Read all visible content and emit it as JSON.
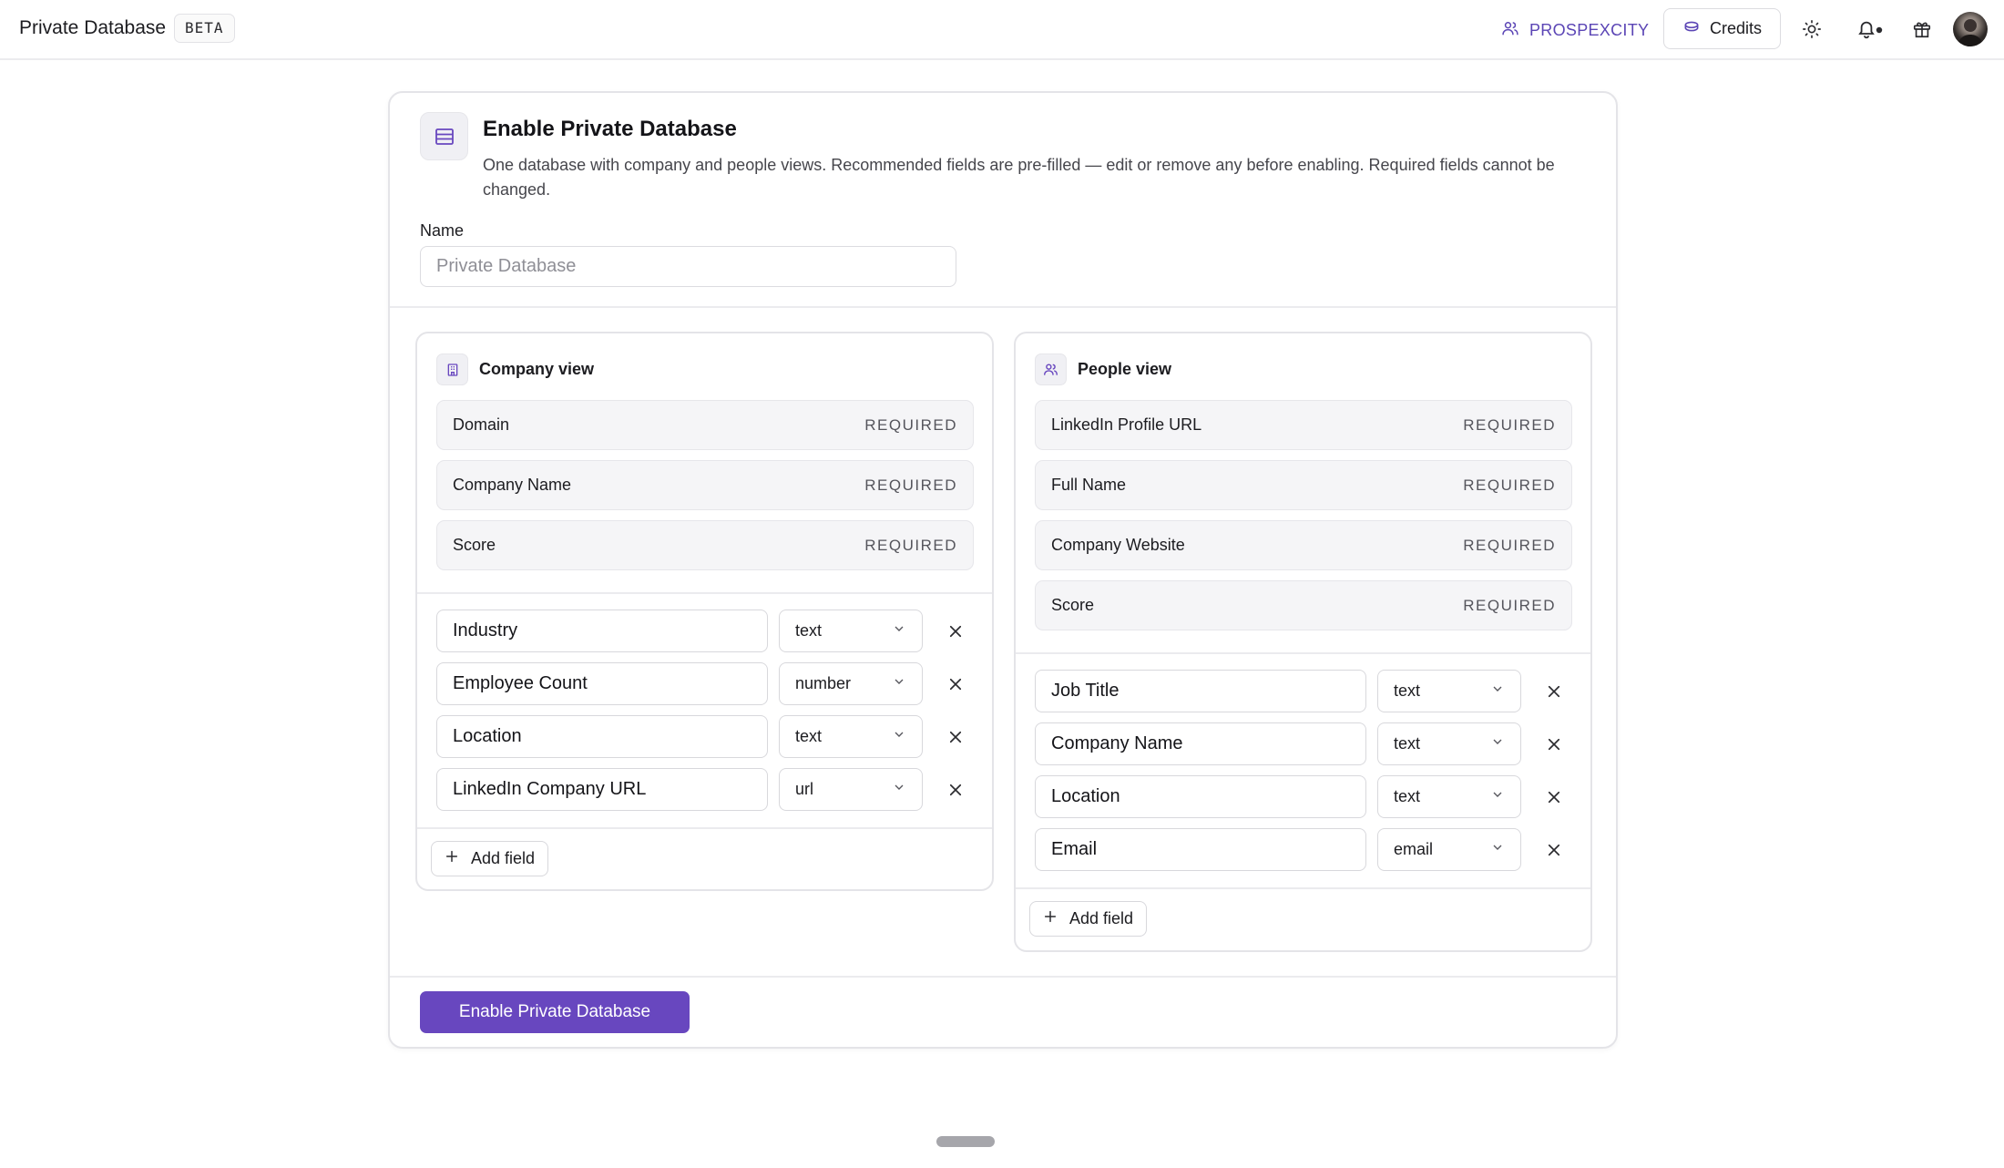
{
  "topbar": {
    "app_title": "Private Database",
    "beta_badge": "BETA",
    "brand_link": "PROSPEXCITY",
    "credits_label": "Credits"
  },
  "card": {
    "title": "Enable Private Database",
    "description": "One database with company and people views. Recommended fields are pre-filled — edit or remove any before enabling. Required fields cannot be changed.",
    "name_label": "Name",
    "name_placeholder": "Private Database",
    "name_value": "",
    "enable_button": "Enable Private Database"
  },
  "company_view": {
    "title": "Company view",
    "required": [
      {
        "name": "Domain",
        "tag": "REQUIRED"
      },
      {
        "name": "Company Name",
        "tag": "REQUIRED"
      },
      {
        "name": "Score",
        "tag": "REQUIRED"
      }
    ],
    "fields": [
      {
        "name": "Industry",
        "type": "text"
      },
      {
        "name": "Employee Count",
        "type": "number"
      },
      {
        "name": "Location",
        "type": "text"
      },
      {
        "name": "LinkedIn Company URL",
        "type": "url"
      }
    ],
    "add_field": "Add field"
  },
  "people_view": {
    "title": "People view",
    "required": [
      {
        "name": "LinkedIn Profile URL",
        "tag": "REQUIRED"
      },
      {
        "name": "Full Name",
        "tag": "REQUIRED"
      },
      {
        "name": "Company Website",
        "tag": "REQUIRED"
      },
      {
        "name": "Score",
        "tag": "REQUIRED"
      }
    ],
    "fields": [
      {
        "name": "Job Title",
        "type": "text"
      },
      {
        "name": "Company Name",
        "type": "text"
      },
      {
        "name": "Location",
        "type": "text"
      },
      {
        "name": "Email",
        "type": "email"
      }
    ],
    "add_field": "Add field"
  },
  "colors": {
    "accent": "#6847bf",
    "brand_text": "#5b45b5",
    "border": "#e4e4e8",
    "required_row_bg": "#f5f5f7"
  },
  "icons": {
    "brand": "users-icon",
    "credits": "coins-icon",
    "theme": "sun-icon",
    "notifications": "bell-icon",
    "gift": "gift-icon",
    "database": "database-icon",
    "company": "building-icon",
    "people": "users-icon",
    "remove": "close-icon",
    "add": "plus-icon",
    "select": "chevron-down-icon"
  }
}
